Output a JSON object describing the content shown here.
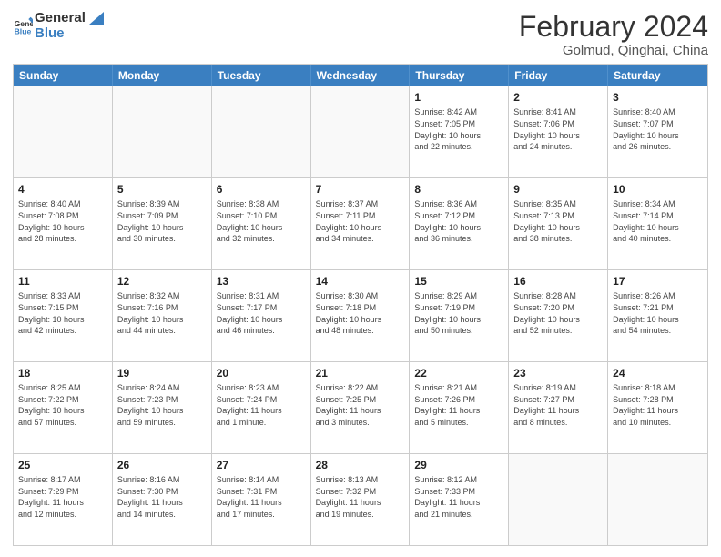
{
  "logo": {
    "line1": "General",
    "line2": "Blue"
  },
  "title": "February 2024",
  "location": "Golmud, Qinghai, China",
  "days": [
    "Sunday",
    "Monday",
    "Tuesday",
    "Wednesday",
    "Thursday",
    "Friday",
    "Saturday"
  ],
  "rows": [
    [
      {
        "date": "",
        "info": ""
      },
      {
        "date": "",
        "info": ""
      },
      {
        "date": "",
        "info": ""
      },
      {
        "date": "",
        "info": ""
      },
      {
        "date": "1",
        "info": "Sunrise: 8:42 AM\nSunset: 7:05 PM\nDaylight: 10 hours\nand 22 minutes."
      },
      {
        "date": "2",
        "info": "Sunrise: 8:41 AM\nSunset: 7:06 PM\nDaylight: 10 hours\nand 24 minutes."
      },
      {
        "date": "3",
        "info": "Sunrise: 8:40 AM\nSunset: 7:07 PM\nDaylight: 10 hours\nand 26 minutes."
      }
    ],
    [
      {
        "date": "4",
        "info": "Sunrise: 8:40 AM\nSunset: 7:08 PM\nDaylight: 10 hours\nand 28 minutes."
      },
      {
        "date": "5",
        "info": "Sunrise: 8:39 AM\nSunset: 7:09 PM\nDaylight: 10 hours\nand 30 minutes."
      },
      {
        "date": "6",
        "info": "Sunrise: 8:38 AM\nSunset: 7:10 PM\nDaylight: 10 hours\nand 32 minutes."
      },
      {
        "date": "7",
        "info": "Sunrise: 8:37 AM\nSunset: 7:11 PM\nDaylight: 10 hours\nand 34 minutes."
      },
      {
        "date": "8",
        "info": "Sunrise: 8:36 AM\nSunset: 7:12 PM\nDaylight: 10 hours\nand 36 minutes."
      },
      {
        "date": "9",
        "info": "Sunrise: 8:35 AM\nSunset: 7:13 PM\nDaylight: 10 hours\nand 38 minutes."
      },
      {
        "date": "10",
        "info": "Sunrise: 8:34 AM\nSunset: 7:14 PM\nDaylight: 10 hours\nand 40 minutes."
      }
    ],
    [
      {
        "date": "11",
        "info": "Sunrise: 8:33 AM\nSunset: 7:15 PM\nDaylight: 10 hours\nand 42 minutes."
      },
      {
        "date": "12",
        "info": "Sunrise: 8:32 AM\nSunset: 7:16 PM\nDaylight: 10 hours\nand 44 minutes."
      },
      {
        "date": "13",
        "info": "Sunrise: 8:31 AM\nSunset: 7:17 PM\nDaylight: 10 hours\nand 46 minutes."
      },
      {
        "date": "14",
        "info": "Sunrise: 8:30 AM\nSunset: 7:18 PM\nDaylight: 10 hours\nand 48 minutes."
      },
      {
        "date": "15",
        "info": "Sunrise: 8:29 AM\nSunset: 7:19 PM\nDaylight: 10 hours\nand 50 minutes."
      },
      {
        "date": "16",
        "info": "Sunrise: 8:28 AM\nSunset: 7:20 PM\nDaylight: 10 hours\nand 52 minutes."
      },
      {
        "date": "17",
        "info": "Sunrise: 8:26 AM\nSunset: 7:21 PM\nDaylight: 10 hours\nand 54 minutes."
      }
    ],
    [
      {
        "date": "18",
        "info": "Sunrise: 8:25 AM\nSunset: 7:22 PM\nDaylight: 10 hours\nand 57 minutes."
      },
      {
        "date": "19",
        "info": "Sunrise: 8:24 AM\nSunset: 7:23 PM\nDaylight: 10 hours\nand 59 minutes."
      },
      {
        "date": "20",
        "info": "Sunrise: 8:23 AM\nSunset: 7:24 PM\nDaylight: 11 hours\nand 1 minute."
      },
      {
        "date": "21",
        "info": "Sunrise: 8:22 AM\nSunset: 7:25 PM\nDaylight: 11 hours\nand 3 minutes."
      },
      {
        "date": "22",
        "info": "Sunrise: 8:21 AM\nSunset: 7:26 PM\nDaylight: 11 hours\nand 5 minutes."
      },
      {
        "date": "23",
        "info": "Sunrise: 8:19 AM\nSunset: 7:27 PM\nDaylight: 11 hours\nand 8 minutes."
      },
      {
        "date": "24",
        "info": "Sunrise: 8:18 AM\nSunset: 7:28 PM\nDaylight: 11 hours\nand 10 minutes."
      }
    ],
    [
      {
        "date": "25",
        "info": "Sunrise: 8:17 AM\nSunset: 7:29 PM\nDaylight: 11 hours\nand 12 minutes."
      },
      {
        "date": "26",
        "info": "Sunrise: 8:16 AM\nSunset: 7:30 PM\nDaylight: 11 hours\nand 14 minutes."
      },
      {
        "date": "27",
        "info": "Sunrise: 8:14 AM\nSunset: 7:31 PM\nDaylight: 11 hours\nand 17 minutes."
      },
      {
        "date": "28",
        "info": "Sunrise: 8:13 AM\nSunset: 7:32 PM\nDaylight: 11 hours\nand 19 minutes."
      },
      {
        "date": "29",
        "info": "Sunrise: 8:12 AM\nSunset: 7:33 PM\nDaylight: 11 hours\nand 21 minutes."
      },
      {
        "date": "",
        "info": ""
      },
      {
        "date": "",
        "info": ""
      }
    ]
  ]
}
